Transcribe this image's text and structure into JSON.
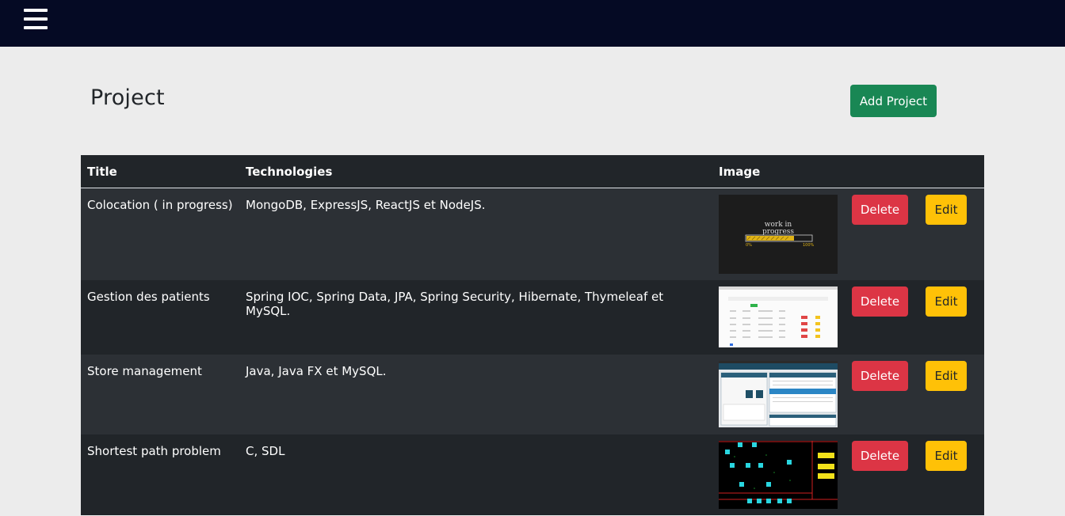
{
  "navbar": {
    "menu_icon": "hamburger-menu-icon"
  },
  "page": {
    "title": "Project",
    "add_button": "Add Project"
  },
  "colors": {
    "navbar": "#050a24",
    "add": "#198754",
    "delete": "#dc3545",
    "edit": "#ffc107",
    "table_dark": "#212529",
    "table_striped": "#2c3035"
  },
  "table": {
    "headers": {
      "title": "Title",
      "technologies": "Technologies",
      "image": "Image"
    },
    "rows": [
      {
        "title": "Colocation ( in progress)",
        "technologies": "MongoDB, ExpressJS, ReactJS et NodeJS.",
        "image_text_1": "work in",
        "image_text_2": "progress",
        "image_text_3": "0%",
        "image_text_4": "100%",
        "delete": "Delete",
        "edit": "Edit"
      },
      {
        "title": "Gestion des patients",
        "technologies": "Spring IOC, Spring Data, JPA, Spring Security, Hibernate, Thymeleaf et MySQL.",
        "delete": "Delete",
        "edit": "Edit"
      },
      {
        "title": "Store management",
        "technologies": "Java, Java FX et MySQL.",
        "delete": "Delete",
        "edit": "Edit"
      },
      {
        "title": "Shortest path problem",
        "technologies": "C, SDL",
        "delete": "Delete",
        "edit": "Edit"
      }
    ]
  }
}
